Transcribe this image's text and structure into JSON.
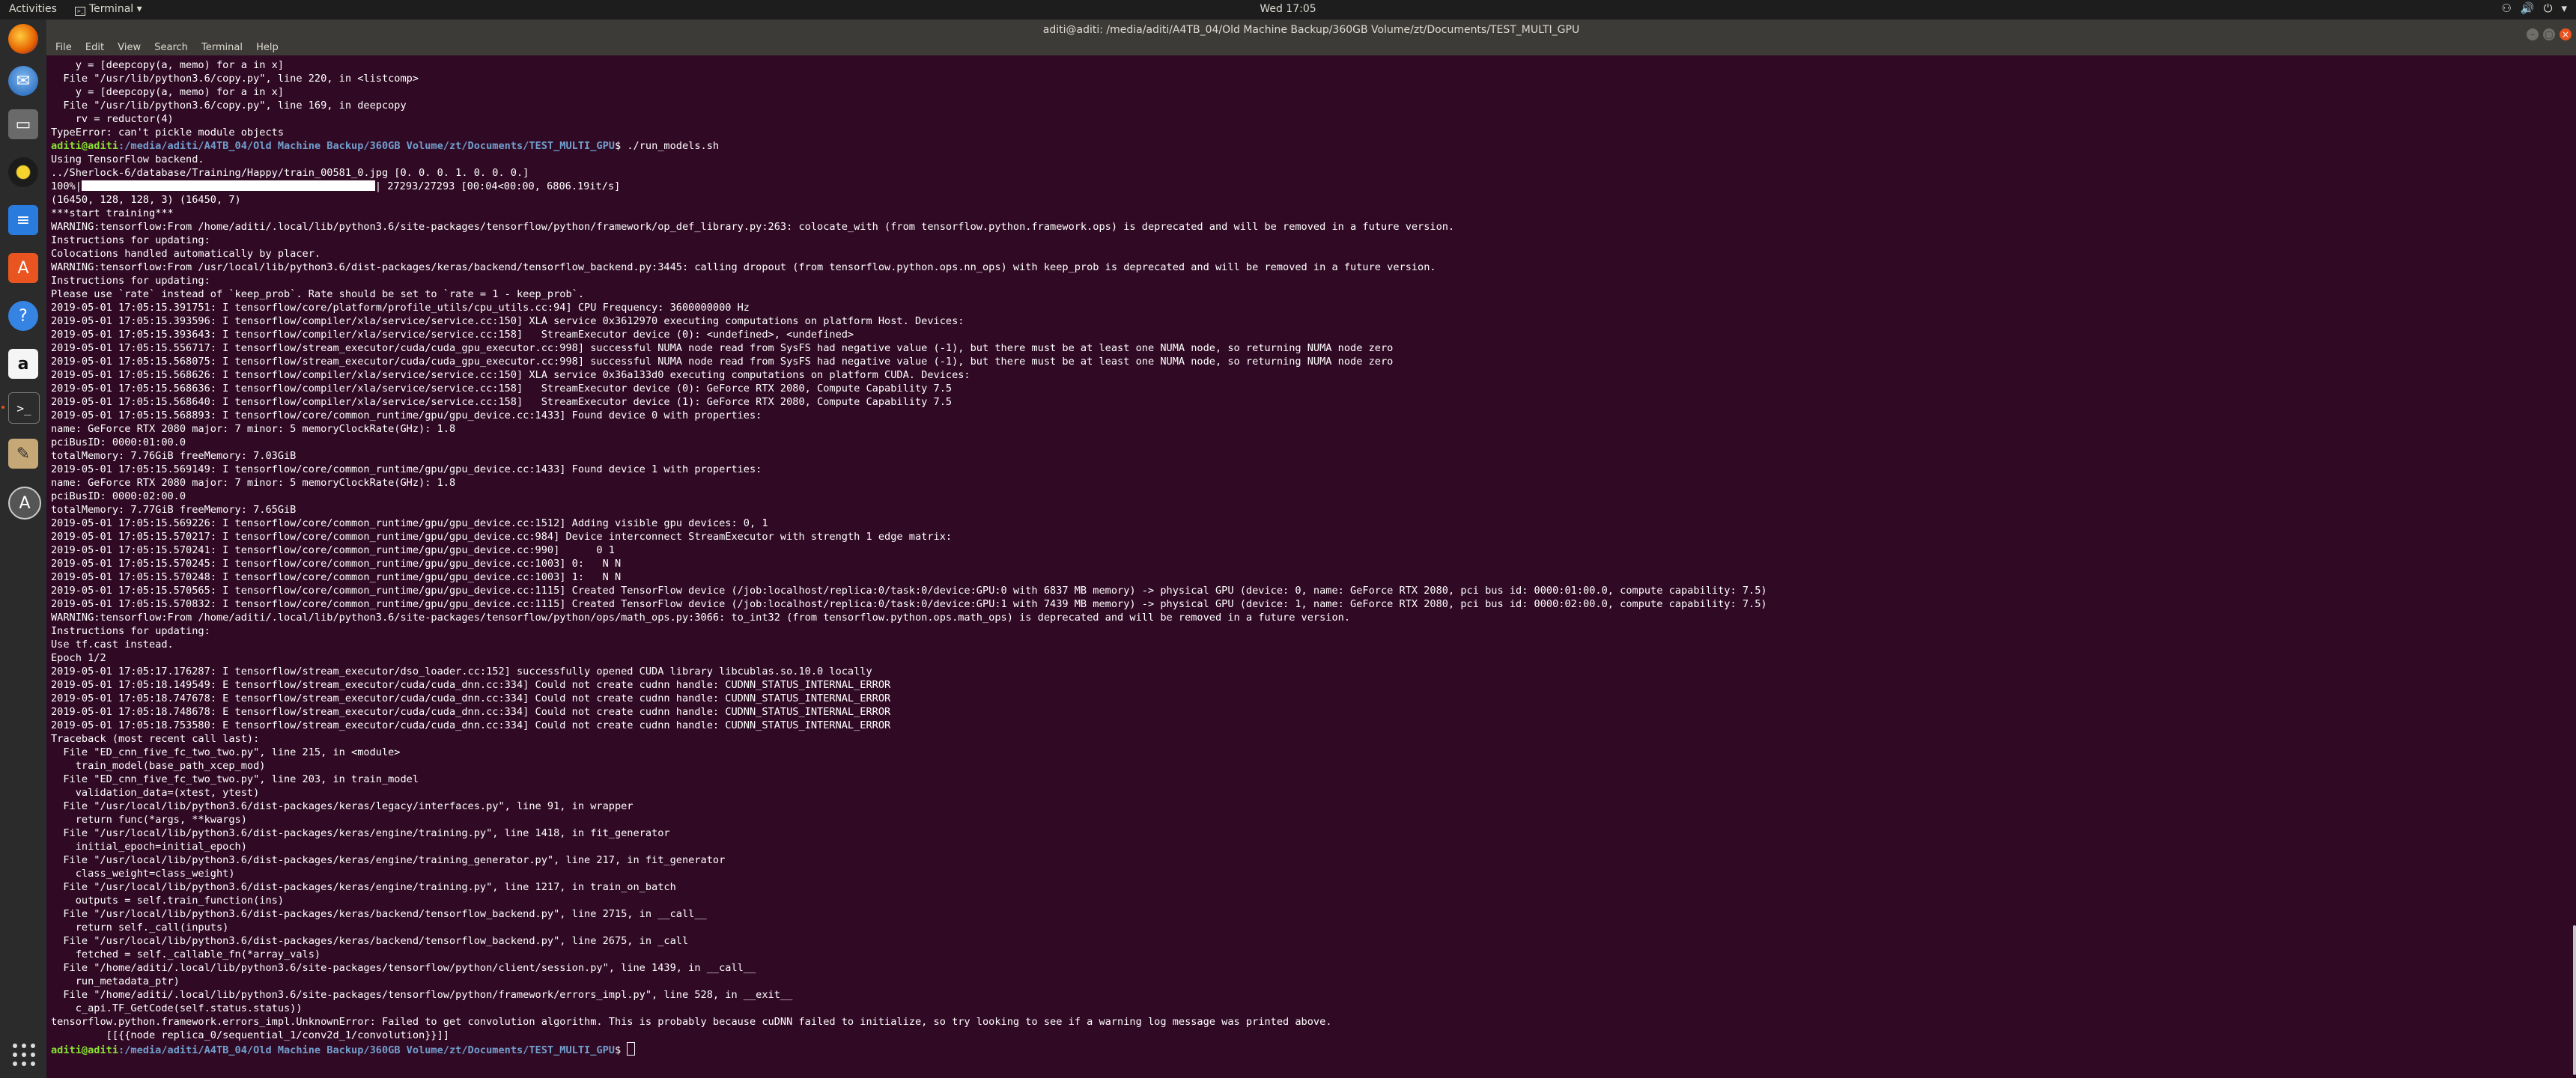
{
  "topbar": {
    "activities": "Activities",
    "app": "Terminal",
    "clock": "Wed 17:05",
    "tray_icons": [
      "network-icon",
      "volume-icon",
      "power-icon"
    ]
  },
  "dock": {
    "items": [
      "firefox-icon",
      "thunderbird-icon",
      "files-icon",
      "rhythmbox-icon",
      "libreoffice-writer-icon",
      "software-center-icon",
      "help-icon",
      "amazon-icon",
      "terminal-icon",
      "text-editor-icon",
      "software-updater-icon"
    ],
    "show_apps": "show-applications-icon"
  },
  "window": {
    "title": "aditi@aditi: /media/aditi/A4TB_04/Old Machine Backup/360GB Volume/zt/Documents/TEST_MULTI_GPU",
    "menu": [
      "File",
      "Edit",
      "View",
      "Search",
      "Terminal",
      "Help"
    ]
  },
  "terminal": {
    "user_host": "aditi@aditi",
    "cwd": ":/media/aditi/A4TB_04/Old Machine Backup/360GB Volume/zt/Documents/TEST_MULTI_GPU",
    "prompt_suffix": "$ ",
    "command": "./run_models.sh",
    "progress_fraction": 1.0,
    "lines_top": [
      "    y = [deepcopy(a, memo) for a in x]",
      "  File \"/usr/lib/python3.6/copy.py\", line 220, in <listcomp>",
      "    y = [deepcopy(a, memo) for a in x]",
      "  File \"/usr/lib/python3.6/copy.py\", line 169, in deepcopy",
      "    rv = reductor(4)",
      "TypeError: can't pickle module objects"
    ],
    "lines_mid_a": [
      "Using TensorFlow backend.",
      "../Sherlock-6/database/Training/Happy/train_00581_0.jpg [0. 0. 0. 1. 0. 0. 0.]"
    ],
    "progress_prefix": "100%|",
    "progress_suffix": "| 27293/27293 [00:04<00:00, 6806.19it/s]",
    "lines_main": [
      "(16450, 128, 128, 3) (16450, 7)",
      "***start training***",
      "WARNING:tensorflow:From /home/aditi/.local/lib/python3.6/site-packages/tensorflow/python/framework/op_def_library.py:263: colocate_with (from tensorflow.python.framework.ops) is deprecated and will be removed in a future version.",
      "Instructions for updating:",
      "Colocations handled automatically by placer.",
      "WARNING:tensorflow:From /usr/local/lib/python3.6/dist-packages/keras/backend/tensorflow_backend.py:3445: calling dropout (from tensorflow.python.ops.nn_ops) with keep_prob is deprecated and will be removed in a future version.",
      "Instructions for updating:",
      "Please use `rate` instead of `keep_prob`. Rate should be set to `rate = 1 - keep_prob`.",
      "2019-05-01 17:05:15.391751: I tensorflow/core/platform/profile_utils/cpu_utils.cc:94] CPU Frequency: 3600000000 Hz",
      "2019-05-01 17:05:15.393596: I tensorflow/compiler/xla/service/service.cc:150] XLA service 0x3612970 executing computations on platform Host. Devices:",
      "2019-05-01 17:05:15.393643: I tensorflow/compiler/xla/service/service.cc:158]   StreamExecutor device (0): <undefined>, <undefined>",
      "2019-05-01 17:05:15.556717: I tensorflow/stream_executor/cuda/cuda_gpu_executor.cc:998] successful NUMA node read from SysFS had negative value (-1), but there must be at least one NUMA node, so returning NUMA node zero",
      "2019-05-01 17:05:15.568075: I tensorflow/stream_executor/cuda/cuda_gpu_executor.cc:998] successful NUMA node read from SysFS had negative value (-1), but there must be at least one NUMA node, so returning NUMA node zero",
      "2019-05-01 17:05:15.568626: I tensorflow/compiler/xla/service/service.cc:150] XLA service 0x36a133d0 executing computations on platform CUDA. Devices:",
      "2019-05-01 17:05:15.568636: I tensorflow/compiler/xla/service/service.cc:158]   StreamExecutor device (0): GeForce RTX 2080, Compute Capability 7.5",
      "2019-05-01 17:05:15.568640: I tensorflow/compiler/xla/service/service.cc:158]   StreamExecutor device (1): GeForce RTX 2080, Compute Capability 7.5",
      "2019-05-01 17:05:15.568893: I tensorflow/core/common_runtime/gpu/gpu_device.cc:1433] Found device 0 with properties:",
      "name: GeForce RTX 2080 major: 7 minor: 5 memoryClockRate(GHz): 1.8",
      "pciBusID: 0000:01:00.0",
      "totalMemory: 7.76GiB freeMemory: 7.03GiB",
      "2019-05-01 17:05:15.569149: I tensorflow/core/common_runtime/gpu/gpu_device.cc:1433] Found device 1 with properties:",
      "name: GeForce RTX 2080 major: 7 minor: 5 memoryClockRate(GHz): 1.8",
      "pciBusID: 0000:02:00.0",
      "totalMemory: 7.77GiB freeMemory: 7.65GiB",
      "2019-05-01 17:05:15.569226: I tensorflow/core/common_runtime/gpu/gpu_device.cc:1512] Adding visible gpu devices: 0, 1",
      "2019-05-01 17:05:15.570217: I tensorflow/core/common_runtime/gpu/gpu_device.cc:984] Device interconnect StreamExecutor with strength 1 edge matrix:",
      "2019-05-01 17:05:15.570241: I tensorflow/core/common_runtime/gpu/gpu_device.cc:990]      0 1",
      "2019-05-01 17:05:15.570245: I tensorflow/core/common_runtime/gpu/gpu_device.cc:1003] 0:   N N",
      "2019-05-01 17:05:15.570248: I tensorflow/core/common_runtime/gpu/gpu_device.cc:1003] 1:   N N",
      "2019-05-01 17:05:15.570565: I tensorflow/core/common_runtime/gpu/gpu_device.cc:1115] Created TensorFlow device (/job:localhost/replica:0/task:0/device:GPU:0 with 6837 MB memory) -> physical GPU (device: 0, name: GeForce RTX 2080, pci bus id: 0000:01:00.0, compute capability: 7.5)",
      "2019-05-01 17:05:15.570832: I tensorflow/core/common_runtime/gpu/gpu_device.cc:1115] Created TensorFlow device (/job:localhost/replica:0/task:0/device:GPU:1 with 7439 MB memory) -> physical GPU (device: 1, name: GeForce RTX 2080, pci bus id: 0000:02:00.0, compute capability: 7.5)",
      "WARNING:tensorflow:From /home/aditi/.local/lib/python3.6/site-packages/tensorflow/python/ops/math_ops.py:3066: to_int32 (from tensorflow.python.ops.math_ops) is deprecated and will be removed in a future version.",
      "Instructions for updating:",
      "Use tf.cast instead.",
      "Epoch 1/2",
      "2019-05-01 17:05:17.176287: I tensorflow/stream_executor/dso_loader.cc:152] successfully opened CUDA library libcublas.so.10.0 locally",
      "2019-05-01 17:05:18.149549: E tensorflow/stream_executor/cuda/cuda_dnn.cc:334] Could not create cudnn handle: CUDNN_STATUS_INTERNAL_ERROR",
      "2019-05-01 17:05:18.747678: E tensorflow/stream_executor/cuda/cuda_dnn.cc:334] Could not create cudnn handle: CUDNN_STATUS_INTERNAL_ERROR",
      "2019-05-01 17:05:18.748678: E tensorflow/stream_executor/cuda/cuda_dnn.cc:334] Could not create cudnn handle: CUDNN_STATUS_INTERNAL_ERROR",
      "2019-05-01 17:05:18.753580: E tensorflow/stream_executor/cuda/cuda_dnn.cc:334] Could not create cudnn handle: CUDNN_STATUS_INTERNAL_ERROR",
      "Traceback (most recent call last):",
      "  File \"ED_cnn_five_fc_two_two.py\", line 215, in <module>",
      "    train_model(base_path_xcep_mod)",
      "  File \"ED_cnn_five_fc_two_two.py\", line 203, in train_model",
      "    validation_data=(xtest, ytest)",
      "  File \"/usr/local/lib/python3.6/dist-packages/keras/legacy/interfaces.py\", line 91, in wrapper",
      "    return func(*args, **kwargs)",
      "  File \"/usr/local/lib/python3.6/dist-packages/keras/engine/training.py\", line 1418, in fit_generator",
      "    initial_epoch=initial_epoch)",
      "  File \"/usr/local/lib/python3.6/dist-packages/keras/engine/training_generator.py\", line 217, in fit_generator",
      "    class_weight=class_weight)",
      "  File \"/usr/local/lib/python3.6/dist-packages/keras/engine/training.py\", line 1217, in train_on_batch",
      "    outputs = self.train_function(ins)",
      "  File \"/usr/local/lib/python3.6/dist-packages/keras/backend/tensorflow_backend.py\", line 2715, in __call__",
      "    return self._call(inputs)",
      "  File \"/usr/local/lib/python3.6/dist-packages/keras/backend/tensorflow_backend.py\", line 2675, in _call",
      "    fetched = self._callable_fn(*array_vals)",
      "  File \"/home/aditi/.local/lib/python3.6/site-packages/tensorflow/python/client/session.py\", line 1439, in __call__",
      "    run_metadata_ptr)",
      "  File \"/home/aditi/.local/lib/python3.6/site-packages/tensorflow/python/framework/errors_impl.py\", line 528, in __exit__",
      "    c_api.TF_GetCode(self.status.status))",
      "tensorflow.python.framework.errors_impl.UnknownError: Failed to get convolution algorithm. This is probably because cuDNN failed to initialize, so try looking to see if a warning log message was printed above.",
      "         [[{{node replica_0/sequential_1/conv2d_1/convolution}}]]"
    ]
  }
}
